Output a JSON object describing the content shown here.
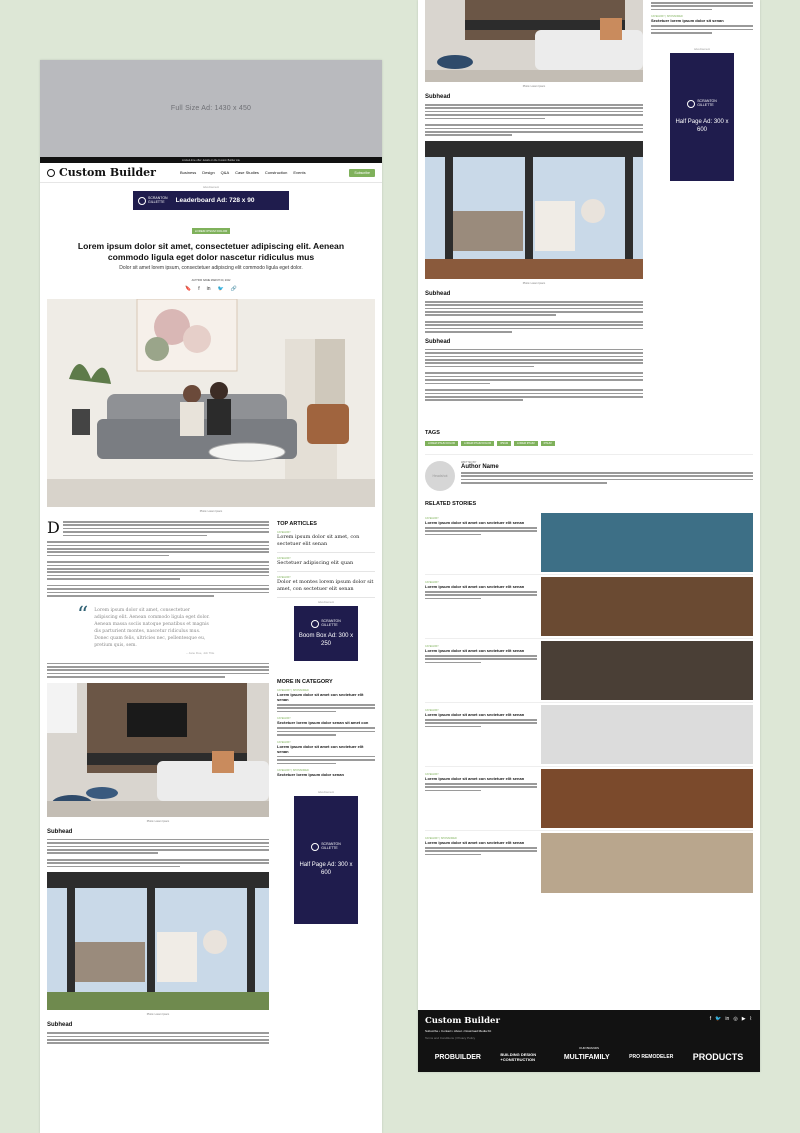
{
  "left": {
    "top_ad": "Full Size Ad: 1430 x 450",
    "promo_bar": "Limited-time offer: details on the Custom Builder site",
    "logo": "Custom Builder",
    "nav": [
      "Business",
      "Design",
      "Q&A",
      "Case Studies",
      "Construction",
      "Events"
    ],
    "subscribe": "Subscribe",
    "ad_label": "Advertisement",
    "leaderboard": "Leaderboard Ad: 728 x 90",
    "sponsor": [
      "SCRANTON",
      "GILLETTE",
      "COMMUNICATIONS"
    ],
    "category": "LOREM IPSUM DOLOR",
    "headline": "Lorem ipsum dolor sit amet, consectetuer adipiscing elit. Aenean commodo ligula eget dolor nascetur ridiculus mus",
    "dek": "Dolor sit amet lorem ipsum, consectetuer adipiscing elit commodo ligula eget dolor.",
    "byline": "AUTHOR NAME   MARCH 00, 2022",
    "share": [
      "🔖",
      "f",
      "in",
      "🐦",
      "🔗"
    ],
    "photo_caption": "Photo: Lorem Ipsum",
    "dropcap": "D",
    "quote": "Lorem ipsum dolor sit amet, consectetuer adipiscing elit. Aenean commodo ligula eget dolor. Aenean massa sociis natoque penatibus et magnis dis parturient montes, nascetur ridiculus mus. Donec quam felis, ultricies nec, pellentesque eu, pretium quis, sem.",
    "quote_attr": "– Jane Doe, Job Title",
    "subhead": "Subhead",
    "top_articles": {
      "heading": "TOP ARTICLES",
      "category": "CATEGORY",
      "items": [
        "Lorem ipsum dolor sit amet, con sectetuer elit senan",
        "Sectetuer adipiscing elit quan",
        "Dolor et montes lorem ipsum dolor sit amet, con sectetuer elit senan"
      ]
    },
    "boombox": "Boom Box Ad: 300 x 250",
    "more_in_category": {
      "heading": "MORE IN CATEGORY",
      "category": "CATEGORY",
      "sponsored": "CATEGORY | SPONSORED",
      "items": [
        "Lorem ipsum dolor sit amet con sectetuer elit senan",
        "Sectetuer lorem ipsum dolor senan sit amet con",
        "Lorem ipsum dolor sit amet con sectetuer elit senan",
        "Sectetuer lorem ipsum dolor senan"
      ]
    },
    "halfpage": "Half Page Ad: 300 x 600"
  },
  "right": {
    "caption": "Photo: Lorem Ipsum",
    "subhead": "Subhead",
    "sidebar_items": [
      "Sectetuer lorem ipsum dolor sit senan",
      "Sectetuer lorem ipsum dolor sit senan"
    ],
    "sponsored": "CATEGORY | SPONSORED",
    "halfpage": "Half Page Ad: 300 x 600",
    "tags_heading": "TAGS",
    "tags": [
      "LOREM IPSUM DOLOR",
      "LOREM IPSUM DOLOR",
      "IPSUM",
      "LOREM IPSUM",
      "IPSUM"
    ],
    "author_label": "WRITTEN BY",
    "author_name": "Author Name",
    "author_avatar": "Headshot",
    "related_heading": "RELATED STORIES",
    "related": [
      {
        "cat": "CATEGORY",
        "title": "Lorem ipsum dolor sit amet con sectetuer elit senan"
      },
      {
        "cat": "CATEGORY",
        "title": "Lorem ipsum dolor sit amet con sectetuer elit senan"
      },
      {
        "cat": "CATEGORY",
        "title": "Lorem ipsum dolor sit amet con sectetuer elit senan"
      },
      {
        "cat": "CATEGORY",
        "title": "Lorem ipsum dolor sit amet con sectetuer elit senan"
      },
      {
        "cat": "CATEGORY",
        "title": "Lorem ipsum dolor sit amet con sectetuer elit senan"
      },
      {
        "cat": "CATEGORY | SPONSORED",
        "title": "Lorem ipsum dolor sit amet con sectetuer elit senan"
      }
    ],
    "footer": {
      "logo": "Custom Builder",
      "links": "Subscribe  •  Contact  •  About  •  Download Media Kit",
      "legal": "Terms and Conditions  |  Privacy Policy",
      "social": [
        "f",
        "🐦",
        "in",
        "◎",
        "▶",
        "⌇"
      ],
      "brands_label": "OUR BRANDS",
      "brands": [
        "PROBUILDER",
        "BUILDING DESIGN +CONSTRUCTION",
        "MULTIFAMILY",
        "PRO REMODELER",
        "PRODUCTS"
      ]
    }
  }
}
